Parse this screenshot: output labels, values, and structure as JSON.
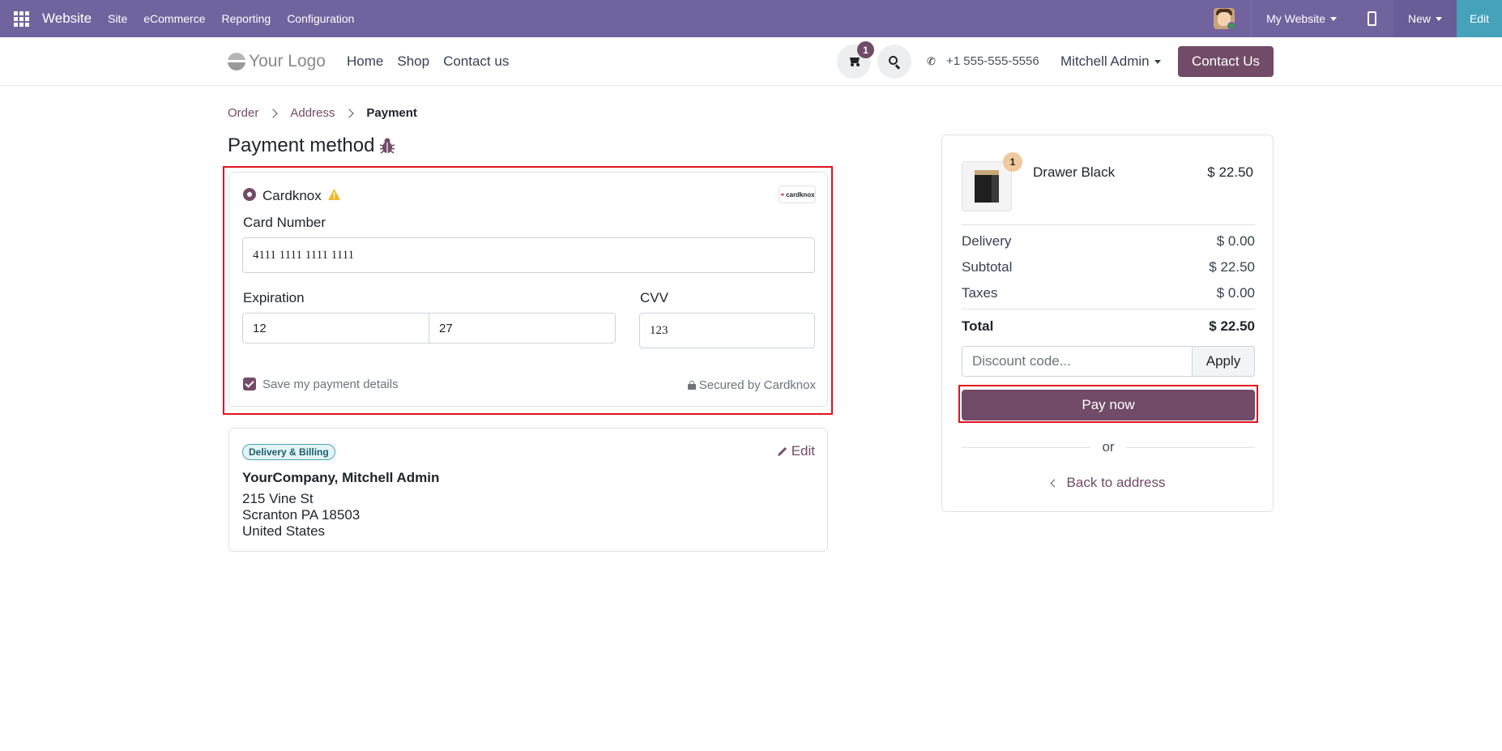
{
  "topbar": {
    "brand": "Website",
    "menu": [
      "Site",
      "eCommerce",
      "Reporting",
      "Configuration"
    ],
    "website_selector": "My Website",
    "new_label": "New",
    "edit_label": "Edit",
    "bg_color": "#71639e"
  },
  "header": {
    "logo_text": "Your Logo",
    "nav": [
      "Home",
      "Shop",
      "Contact us"
    ],
    "cart_count": "1",
    "phone": "+1 555-555-5556",
    "user": "Mitchell Admin",
    "contact_button": "Contact Us"
  },
  "breadcrumb": {
    "items": [
      "Order",
      "Address",
      "Payment"
    ]
  },
  "payment": {
    "title": "Payment method",
    "provider": "Cardknox",
    "provider_logo_text": "cardknox",
    "card_number_label": "Card Number",
    "card_number_value": "4111 1111 1111 1111",
    "expiration_label": "Expiration",
    "exp_month": "12",
    "exp_year": "27",
    "cvv_label": "CVV",
    "cvv_value": "123",
    "save_details_label": "Save my payment details",
    "save_details_checked": true,
    "secured_label": "Secured by Cardknox"
  },
  "address": {
    "badge": "Delivery & Billing",
    "edit_label": "Edit",
    "name": "YourCompany, Mitchell Admin",
    "lines": [
      "215 Vine St",
      "Scranton PA 18503",
      "United States"
    ]
  },
  "summary": {
    "product_name": "Drawer Black",
    "product_qty": "1",
    "product_price": "$ 22.50",
    "rows": [
      {
        "label": "Delivery",
        "value": "$ 0.00"
      },
      {
        "label": "Subtotal",
        "value": "$ 22.50"
      },
      {
        "label": "Taxes",
        "value": "$ 0.00"
      }
    ],
    "total_label": "Total",
    "total_value": "$ 22.50",
    "discount_placeholder": "Discount code...",
    "apply_label": "Apply",
    "pay_label": "Pay now",
    "or_label": "or",
    "back_label": "Back to address"
  },
  "colors": {
    "primary": "#714b67",
    "highlight": "#e0141e",
    "edit_button": "#45a2b8"
  }
}
